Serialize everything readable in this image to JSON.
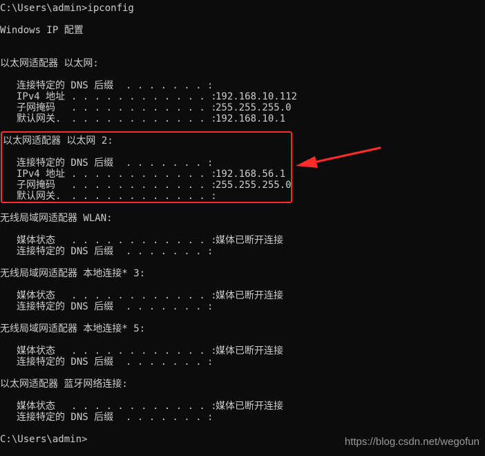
{
  "console": {
    "command_line": "C:\\Users\\admin>ipconfig",
    "header": "Windows IP 配置",
    "adapters": [
      {
        "title": "以太网适配器 以太网:",
        "rows": [
          {
            "label": "连接特定的 DNS 后缀",
            "value": ""
          },
          {
            "label": "IPv4 地址",
            "value": "192.168.10.112"
          },
          {
            "label": "子网掩码",
            "value": "255.255.255.0"
          },
          {
            "label": "默认网关.",
            "value": "192.168.10.1"
          }
        ]
      },
      {
        "title": "以太网适配器 以太网 2:",
        "rows": [
          {
            "label": "连接特定的 DNS 后缀",
            "value": ""
          },
          {
            "label": "IPv4 地址",
            "value": "192.168.56.1"
          },
          {
            "label": "子网掩码",
            "value": "255.255.255.0"
          },
          {
            "label": "默认网关.",
            "value": ""
          }
        ]
      },
      {
        "title": "无线局域网适配器 WLAN:",
        "rows": [
          {
            "label": "媒体状态",
            "value": "媒体已断开连接"
          },
          {
            "label": "连接特定的 DNS 后缀",
            "value": ""
          }
        ]
      },
      {
        "title": "无线局域网适配器 本地连接* 3:",
        "rows": [
          {
            "label": "媒体状态",
            "value": "媒体已断开连接"
          },
          {
            "label": "连接特定的 DNS 后缀",
            "value": ""
          }
        ]
      },
      {
        "title": "无线局域网适配器 本地连接* 5:",
        "rows": [
          {
            "label": "媒体状态",
            "value": "媒体已断开连接"
          },
          {
            "label": "连接特定的 DNS 后缀",
            "value": ""
          }
        ]
      },
      {
        "title": "以太网适配器 蓝牙网络连接:",
        "rows": [
          {
            "label": "媒体状态",
            "value": "媒体已断开连接"
          },
          {
            "label": "连接特定的 DNS 后缀",
            "value": ""
          }
        ]
      }
    ],
    "prompt": "C:\\Users\\admin>"
  },
  "watermark": "https://blog.csdn.net/wegofun",
  "colors": {
    "background": "#0c0c0c",
    "text": "#cccccc",
    "highlight": "#ff2a2a"
  }
}
